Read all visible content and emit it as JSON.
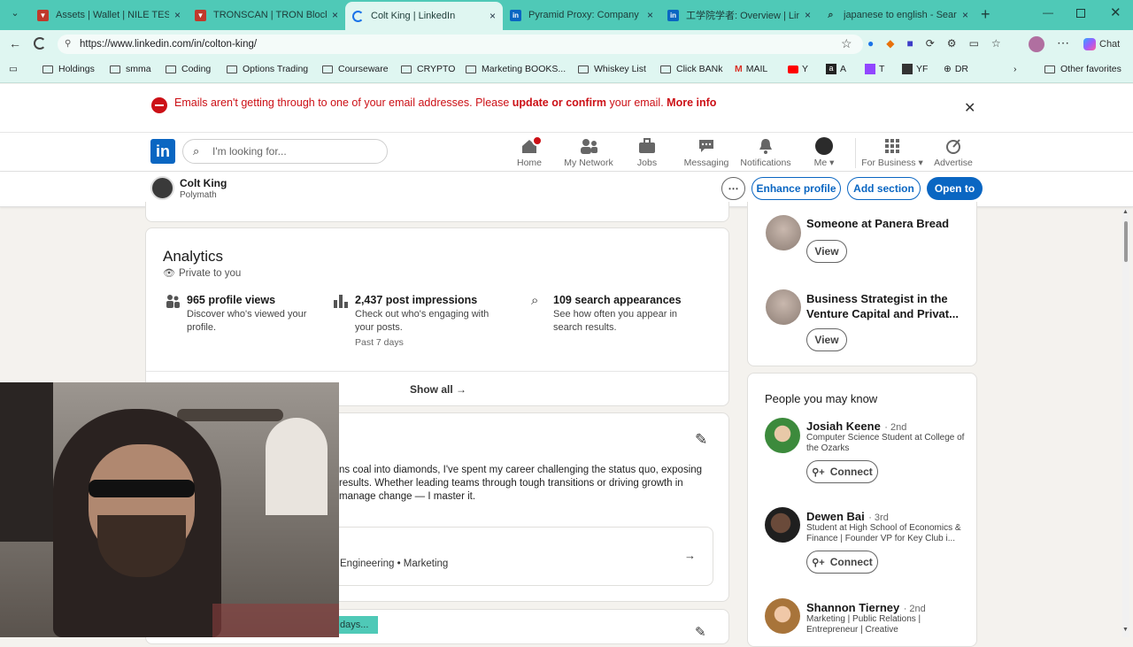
{
  "browser": {
    "tabs": [
      {
        "title": "Assets | Wallet | NILE TESTNET",
        "favicon": "tron-icon"
      },
      {
        "title": "TRONSCAN | TRON BlockChain",
        "favicon": "tron-icon"
      },
      {
        "title": "Colt King | LinkedIn",
        "favicon": "loading-icon"
      },
      {
        "title": "Pyramid Proxy: Company Page",
        "favicon": "linkedin-icon"
      },
      {
        "title": "工学院学者: Overview | LinkedIn",
        "favicon": "linkedin-icon"
      },
      {
        "title": "japanese to english - Search",
        "favicon": "search-icon"
      }
    ],
    "url": "https://www.linkedin.com/in/colton-king/",
    "chat_label": "Chat",
    "bookmarks": [
      "Holdings",
      "smma",
      "Coding",
      "Options Trading",
      "Courseware",
      "CRYPTO",
      "Marketing BOOKS...",
      "Whiskey List",
      "Click BANk",
      "MAIL",
      "Y",
      "A",
      "T",
      "YF",
      "DR"
    ],
    "other_favorites": "Other favorites"
  },
  "alert": {
    "text": "Emails aren't getting through to one of your email addresses. Please",
    "link": "update or confirm",
    "text2": "your email.",
    "more": "More info"
  },
  "nav": {
    "search_placeholder": "I'm looking for...",
    "items": [
      "Home",
      "My Network",
      "Jobs",
      "Messaging",
      "Notifications",
      "Me",
      "For Business",
      "Advertise"
    ]
  },
  "profile_bar": {
    "name": "Colt King",
    "headline": "Polymath",
    "enhance": "Enhance profile",
    "add_section": "Add section",
    "open_to": "Open to"
  },
  "analytics": {
    "title": "Analytics",
    "private": "Private to you",
    "stats": [
      {
        "title": "965 profile views",
        "desc": "Discover who's viewed your profile."
      },
      {
        "title": "2,437 post impressions",
        "desc": "Check out who's engaging with your posts.",
        "note": "Past 7 days"
      },
      {
        "title": "109 search appearances",
        "desc": "See how often you appear in search results."
      }
    ],
    "show_all": "Show all"
  },
  "about": {
    "text": "ns coal into diamonds, I've spent my career challenging the status quo, exposing results. Whether leading teams through tough transitions or driving growth in manage change — I master it.",
    "skills": "Engineering • Marketing",
    "bottom_tag": "days..."
  },
  "viewers": [
    {
      "name": "Someone at Panera Bread",
      "button": "View"
    },
    {
      "name": "Business Strategist in the Venture Capital and Privat...",
      "button": "View"
    }
  ],
  "pymk": {
    "title": "People you may know",
    "people": [
      {
        "name": "Josiah Keene",
        "degree": "· 2nd",
        "desc": "Computer Science Student at College of the Ozarks",
        "button": "Connect"
      },
      {
        "name": "Dewen Bai",
        "degree": "· 3rd",
        "desc": "Student at High School of Economics & Finance | Founder VP for Key Club i...",
        "button": "Connect"
      },
      {
        "name": "Shannon Tierney",
        "degree": "· 2nd",
        "desc": "Marketing | Public Relations | Entrepreneur | Creative",
        "button": ""
      }
    ]
  }
}
